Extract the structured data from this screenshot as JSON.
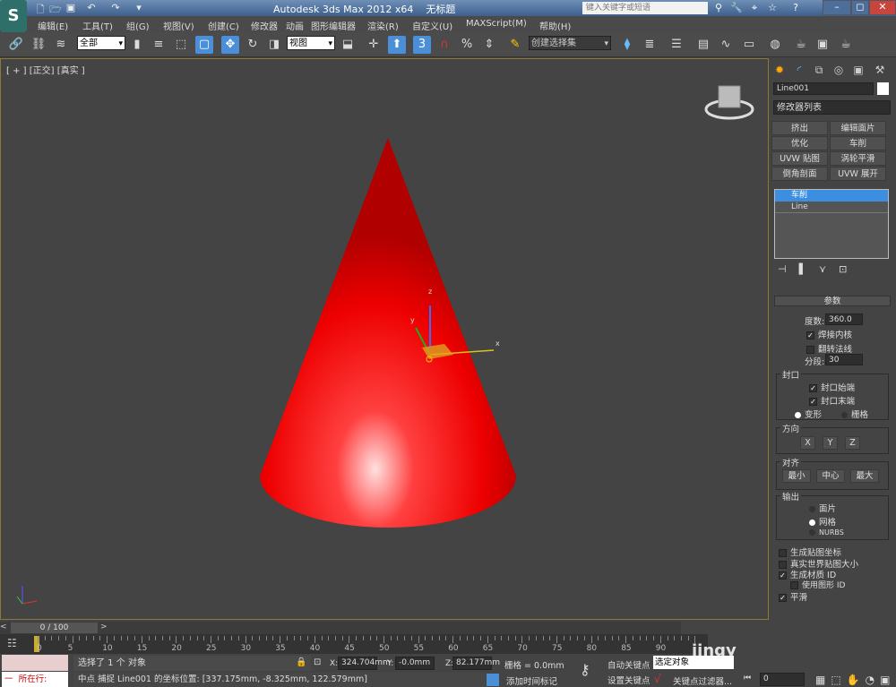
{
  "title": {
    "app": "Autodesk 3ds Max  2012 x64",
    "doc": "无标题",
    "search_placeholder": "键入关键字或短语"
  },
  "menu": [
    "编辑(E)",
    "工具(T)",
    "组(G)",
    "视图(V)",
    "创建(C)",
    "修改器",
    "动画",
    "图形编辑器",
    "渲染(R)",
    "自定义(U)",
    "MAXScript(M)",
    "帮助(H)"
  ],
  "toolbar": {
    "filter": "全部",
    "ref_coord": "视图",
    "selection_set": "创建选择集",
    "snap_label": "3"
  },
  "viewport": {
    "label": "[ + ] [正交] [真实 ]",
    "object_color": "#ff0000",
    "gizmo": {
      "x": "x",
      "y": "y",
      "z": "z"
    }
  },
  "panel": {
    "object_name": "Line001",
    "modifier_list": "修改器列表",
    "modifier_buttons": [
      "挤出",
      "编辑面片",
      "优化",
      "车削",
      "UVW 贴图",
      "涡轮平滑",
      "倒角剖面",
      "UVW 展开"
    ],
    "stack": [
      "车削",
      "Line"
    ],
    "params": {
      "title": "参数",
      "degrees_label": "度数:",
      "degrees": "360.0",
      "weld_core": "焊接内核",
      "flip_normals": "翻转法线",
      "segments_label": "分段:",
      "segments": "30",
      "capping": {
        "title": "封口",
        "start": "封口始端",
        "end": "封口末端",
        "morph": "变形",
        "grid": "栅格"
      },
      "direction": {
        "title": "方向",
        "buttons": [
          "X",
          "Y",
          "Z"
        ]
      },
      "align": {
        "title": "对齐",
        "buttons": [
          "最小",
          "中心",
          "最大"
        ]
      },
      "output": {
        "title": "输出",
        "options": [
          "面片",
          "网格",
          "NURBS"
        ]
      },
      "gen_map_coords": "生成贴图坐标",
      "real_world": "真实世界贴图大小",
      "gen_mat_ids": "生成材质 ID",
      "use_shape_ids": "使用图形 ID",
      "smooth": "平滑"
    }
  },
  "timeline": {
    "frame": "0 / 100",
    "ticks": [
      "0",
      "5",
      "10",
      "15",
      "20",
      "25",
      "30",
      "35",
      "40",
      "45",
      "50",
      "55",
      "60",
      "65",
      "70",
      "75",
      "80",
      "85",
      "90"
    ]
  },
  "status": {
    "selected": "选择了 1 个 对象",
    "prompt": "中点 捕捉 Line001 的坐标位置: [337.175mm, -8.325mm, 122.579mm]",
    "x": "324.704mm",
    "y": "-0.0mm",
    "z": "82.177mm",
    "grid": "栅格 = 0.0mm",
    "add_time_tag": "添加时间标记",
    "auto_key": "自动关键点",
    "set_key": "设置关键点",
    "key_mode": "选定对象",
    "key_filters": "关键点过滤器...",
    "current_frame": "0",
    "listener": "所在行:",
    "listener_prefix": "一"
  },
  "watermark": "jingy"
}
